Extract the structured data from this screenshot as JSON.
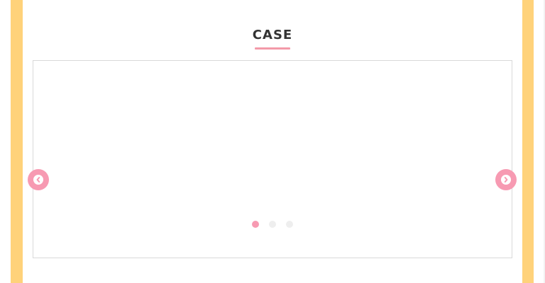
{
  "section": {
    "title": "CASE"
  },
  "carousel": {
    "active_slide": 1,
    "total_slides": 3,
    "prev_icon": "chevron-left-icon",
    "next_icon": "chevron-right-icon"
  },
  "colors": {
    "frame": "#ffd27a",
    "accent": "#f79ab2",
    "underline": "#f39aa9",
    "title_text": "#333333",
    "dot_inactive": "#eeeeee",
    "border": "#d9d9d9"
  }
}
